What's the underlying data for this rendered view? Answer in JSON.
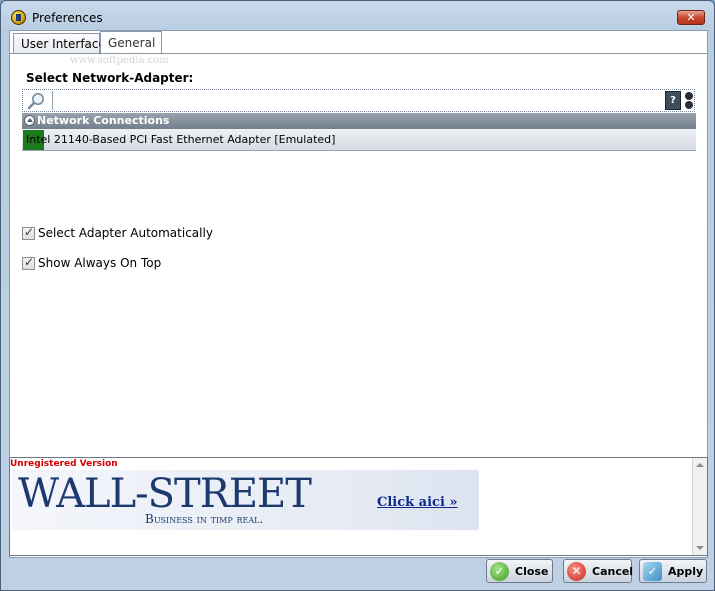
{
  "window": {
    "title": "Preferences",
    "close_glyph": "✕"
  },
  "tabs": [
    {
      "label": "User Interface",
      "active": false
    },
    {
      "label": "General",
      "active": true
    }
  ],
  "watermark": "www.softpedia.com",
  "adapter_section": {
    "label": "Select Network-Adapter:",
    "search_value": "",
    "help_glyph": "?",
    "group_header": "Network Connections",
    "adapters": [
      {
        "name": "Intel 21140-Based PCI Fast Ethernet Adapter [Emulated]",
        "status_color": "#1e7a1e"
      }
    ]
  },
  "options": {
    "select_auto_label": "Select Adapter Automatically",
    "select_auto_checked": true,
    "always_on_top_label": "Show Always On Top",
    "always_on_top_checked": true
  },
  "ad": {
    "unregistered_text": "Unregistered Version",
    "brand": "WALL-STREET",
    "tagline": "Business in timp real.",
    "link_text": "Click aici »"
  },
  "buttons": {
    "close_label": "Close",
    "cancel_label": "Cancel",
    "apply_label": "Apply",
    "close_glyph": "✓",
    "cancel_glyph": "✕",
    "apply_glyph": "✓"
  },
  "icons": {
    "app": "app-icon",
    "search": "search-icon",
    "help": "help-icon",
    "options": "options-icon",
    "collapse": "collapse-icon"
  }
}
